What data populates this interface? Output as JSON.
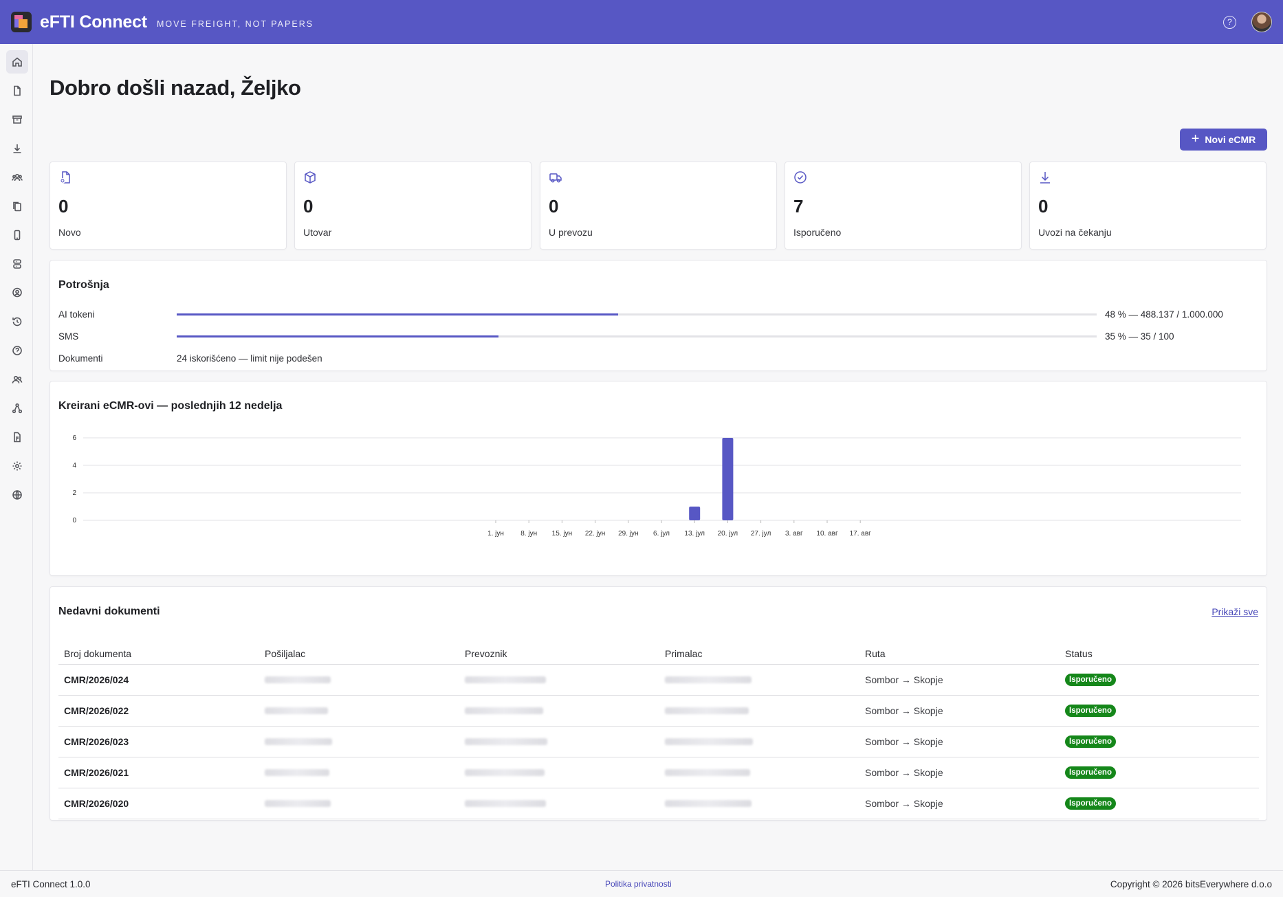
{
  "header": {
    "app_title": "eFTI Connect",
    "tagline": "MOVE FREIGHT, NOT PAPERS",
    "help_label": "?"
  },
  "sidebar": {
    "items": [
      {
        "icon": "home-icon",
        "active": true
      },
      {
        "icon": "document-icon"
      },
      {
        "icon": "archive-icon"
      },
      {
        "icon": "download-icon"
      },
      {
        "icon": "team-icon"
      },
      {
        "icon": "copy-icon"
      },
      {
        "icon": "phone-icon"
      },
      {
        "icon": "server-icon"
      },
      {
        "icon": "location-user-icon"
      },
      {
        "icon": "history-icon"
      },
      {
        "icon": "help-icon"
      },
      {
        "icon": "users-icon"
      },
      {
        "icon": "network-icon"
      },
      {
        "icon": "report-icon"
      },
      {
        "icon": "settings-icon"
      },
      {
        "icon": "globe-icon"
      }
    ]
  },
  "page": {
    "title": "Dobro došli nazad, Željko",
    "new_button": "Novi eCMR"
  },
  "stats": [
    {
      "icon": "new-document-icon",
      "value": "0",
      "label": "Novo"
    },
    {
      "icon": "box-icon",
      "value": "0",
      "label": "Utovar"
    },
    {
      "icon": "truck-icon",
      "value": "0",
      "label": "U prevozu"
    },
    {
      "icon": "check-circle-icon",
      "value": "7",
      "label": "Isporučeno"
    },
    {
      "icon": "download-icon",
      "value": "0",
      "label": "Uvozi na čekanju"
    }
  ],
  "usage": {
    "title": "Potrošnja",
    "rows": [
      {
        "name": "AI tokeni",
        "percent": 48,
        "value": "48 % — 488.137 / 1.000.000"
      },
      {
        "name": "SMS",
        "percent": 35,
        "value": "35 % — 35 / 100"
      },
      {
        "name": "Dokumenti",
        "text": "24 iskorišćeno — limit nije podešen"
      }
    ]
  },
  "chart_data": {
    "type": "bar",
    "title": "Kreirani eCMR-ovi — poslednjih 12 nedelja",
    "categories": [
      "1. јун",
      "8. јун",
      "15. јун",
      "22. јун",
      "29. јун",
      "6. јул",
      "13. јул",
      "20. јул",
      "27. јул",
      "3. авг",
      "10. авг",
      "17. авг"
    ],
    "values": [
      0,
      0,
      0,
      0,
      0,
      0,
      1,
      6,
      0,
      0,
      0,
      0
    ],
    "ylim": [
      0,
      6
    ],
    "yticks": [
      0,
      2,
      4,
      6
    ],
    "grid": true,
    "color": "#5757c4"
  },
  "recent": {
    "title": "Nedavni dokumenti",
    "show_all": "Prikaži sve",
    "columns": [
      "Broj dokumenta",
      "Pošiljalac",
      "Prevoznik",
      "Primalac",
      "Ruta",
      "Status"
    ],
    "rows": [
      {
        "doc": "CMR/2026/024",
        "route": "Sombor → Skopje",
        "status": "Isporučeno"
      },
      {
        "doc": "CMR/2026/022",
        "route": "Sombor → Skopje",
        "status": "Isporučeno"
      },
      {
        "doc": "CMR/2026/023",
        "route": "Sombor → Skopje",
        "status": "Isporučeno"
      },
      {
        "doc": "CMR/2026/021",
        "route": "Sombor → Skopje",
        "status": "Isporučeno"
      },
      {
        "doc": "CMR/2026/020",
        "route": "Sombor → Skopje",
        "status": "Isporučeno"
      }
    ]
  },
  "footer": {
    "version": "eFTI Connect 1.0.0",
    "privacy": "Politika privatnosti",
    "copyright": "Copyright © 2026 bitsEverywhere d.o.o"
  },
  "colors": {
    "brand": "#5757c4",
    "success": "#15871a"
  }
}
